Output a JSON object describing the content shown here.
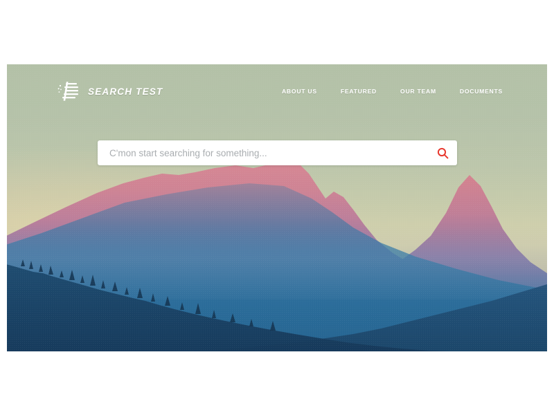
{
  "brand": {
    "name": "SEARCH TEST",
    "logo_icon": "speed-lines-icon"
  },
  "nav": {
    "items": [
      {
        "label": "ABOUT US"
      },
      {
        "label": "FEATURED"
      },
      {
        "label": "OUR TEAM"
      },
      {
        "label": "DOCUMENTS"
      }
    ]
  },
  "search": {
    "placeholder": "C'mon start searching for something...",
    "value": "",
    "button_icon": "search-icon",
    "button_color": "#e8392f"
  },
  "hero": {
    "image_alt": "mountain-landscape-duotone",
    "sky_top_color": "#b3c1a7",
    "sky_horizon_color": "#d4cfab",
    "peak_color": "#d98a96",
    "mountain_color": "#2f7aa8",
    "foreground_color": "#1f4f73"
  },
  "page": {
    "background_color": "#ffffff"
  }
}
